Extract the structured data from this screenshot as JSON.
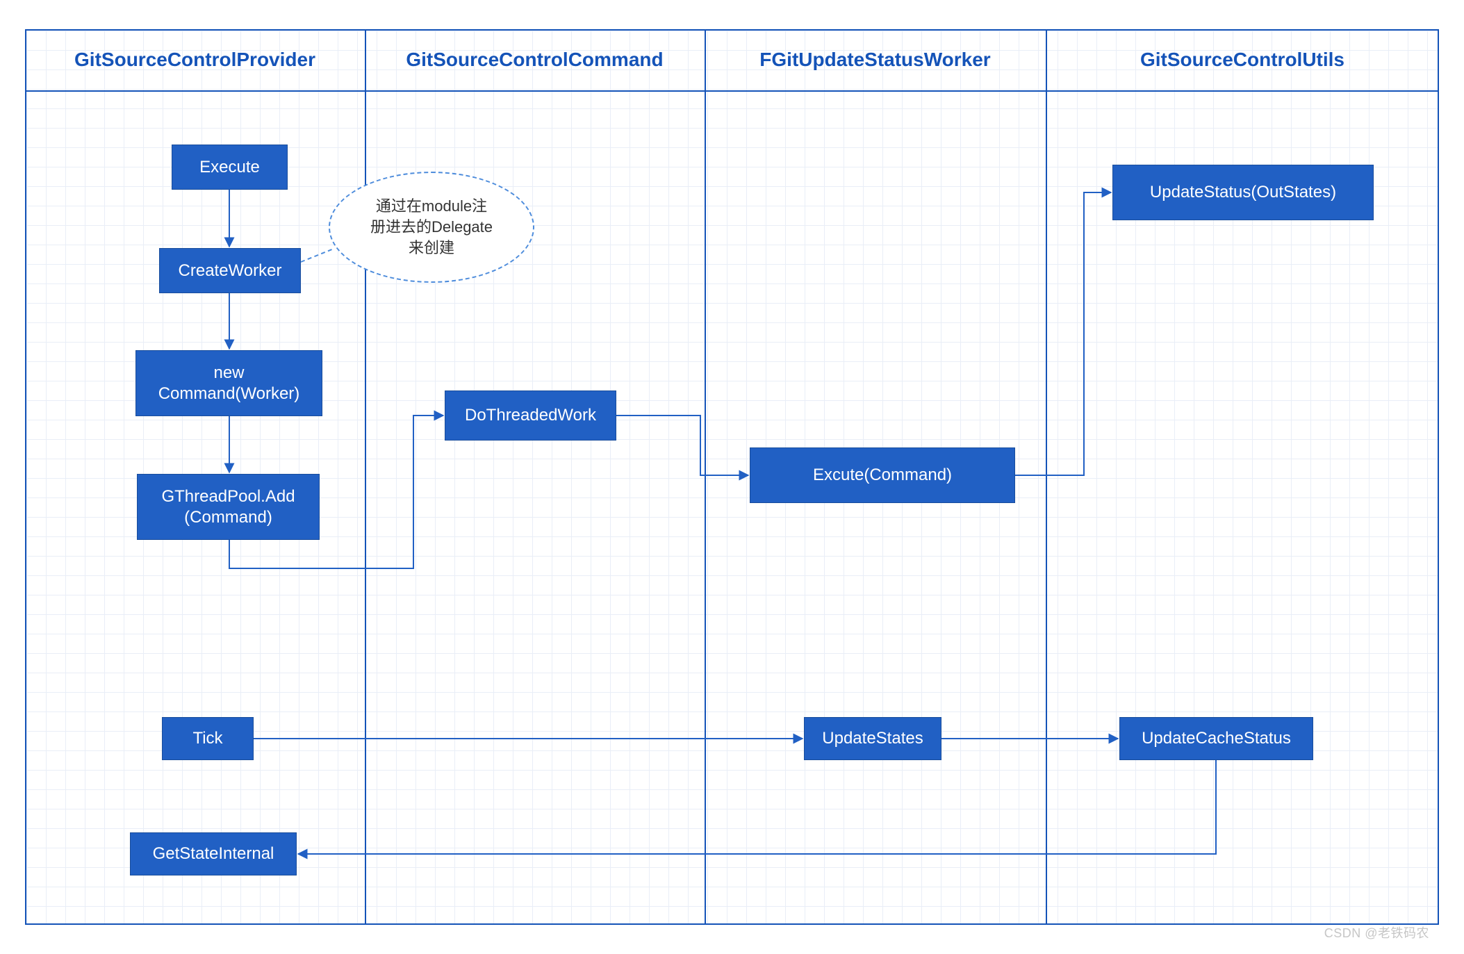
{
  "lanes": {
    "l1": "GitSourceControlProvider",
    "l2": "GitSourceControlCommand",
    "l3": "FGitUpdateStatusWorker",
    "l4": "GitSourceControlUtils"
  },
  "nodes": {
    "execute": "Execute",
    "createWorker": "CreateWorker",
    "newCommand": "new\nCommand(Worker)",
    "gthreadpool": "GThreadPool.Add\n(Command)",
    "tick": "Tick",
    "getStateInternal": "GetStateInternal",
    "doThreadedWork": "DoThreadedWork",
    "excuteCommand": "Excute(Command)",
    "updateStates": "UpdateStates",
    "updateStatusOut": "UpdateStatus(OutStates)",
    "updateCacheStatus": "UpdateCacheStatus"
  },
  "note": {
    "text": "通过在module注\n册进去的Delegate\n来创建"
  },
  "watermark": "CSDN @老铁码农",
  "colors": {
    "lane": "#1453b8",
    "nodeFill": "#2160c4",
    "arrow": "#2160c4"
  }
}
